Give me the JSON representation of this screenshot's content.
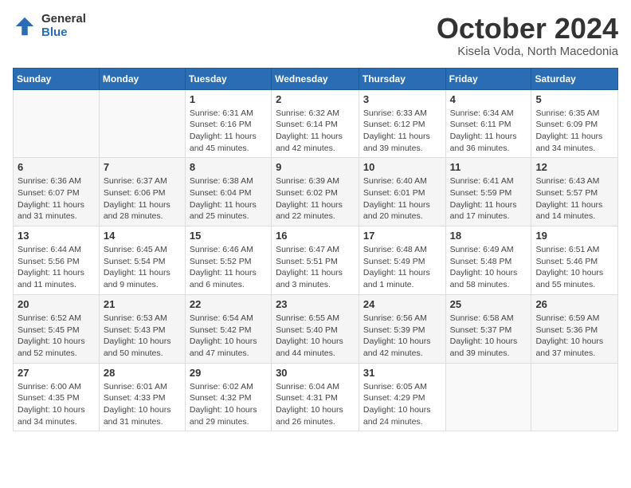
{
  "header": {
    "logo": {
      "general": "General",
      "blue": "Blue"
    },
    "title": "October 2024",
    "location": "Kisela Voda, North Macedonia"
  },
  "weekdays": [
    "Sunday",
    "Monday",
    "Tuesday",
    "Wednesday",
    "Thursday",
    "Friday",
    "Saturday"
  ],
  "weeks": [
    [
      {
        "day": "",
        "info": ""
      },
      {
        "day": "",
        "info": ""
      },
      {
        "day": "1",
        "info": "Sunrise: 6:31 AM\nSunset: 6:16 PM\nDaylight: 11 hours and 45 minutes."
      },
      {
        "day": "2",
        "info": "Sunrise: 6:32 AM\nSunset: 6:14 PM\nDaylight: 11 hours and 42 minutes."
      },
      {
        "day": "3",
        "info": "Sunrise: 6:33 AM\nSunset: 6:12 PM\nDaylight: 11 hours and 39 minutes."
      },
      {
        "day": "4",
        "info": "Sunrise: 6:34 AM\nSunset: 6:11 PM\nDaylight: 11 hours and 36 minutes."
      },
      {
        "day": "5",
        "info": "Sunrise: 6:35 AM\nSunset: 6:09 PM\nDaylight: 11 hours and 34 minutes."
      }
    ],
    [
      {
        "day": "6",
        "info": "Sunrise: 6:36 AM\nSunset: 6:07 PM\nDaylight: 11 hours and 31 minutes."
      },
      {
        "day": "7",
        "info": "Sunrise: 6:37 AM\nSunset: 6:06 PM\nDaylight: 11 hours and 28 minutes."
      },
      {
        "day": "8",
        "info": "Sunrise: 6:38 AM\nSunset: 6:04 PM\nDaylight: 11 hours and 25 minutes."
      },
      {
        "day": "9",
        "info": "Sunrise: 6:39 AM\nSunset: 6:02 PM\nDaylight: 11 hours and 22 minutes."
      },
      {
        "day": "10",
        "info": "Sunrise: 6:40 AM\nSunset: 6:01 PM\nDaylight: 11 hours and 20 minutes."
      },
      {
        "day": "11",
        "info": "Sunrise: 6:41 AM\nSunset: 5:59 PM\nDaylight: 11 hours and 17 minutes."
      },
      {
        "day": "12",
        "info": "Sunrise: 6:43 AM\nSunset: 5:57 PM\nDaylight: 11 hours and 14 minutes."
      }
    ],
    [
      {
        "day": "13",
        "info": "Sunrise: 6:44 AM\nSunset: 5:56 PM\nDaylight: 11 hours and 11 minutes."
      },
      {
        "day": "14",
        "info": "Sunrise: 6:45 AM\nSunset: 5:54 PM\nDaylight: 11 hours and 9 minutes."
      },
      {
        "day": "15",
        "info": "Sunrise: 6:46 AM\nSunset: 5:52 PM\nDaylight: 11 hours and 6 minutes."
      },
      {
        "day": "16",
        "info": "Sunrise: 6:47 AM\nSunset: 5:51 PM\nDaylight: 11 hours and 3 minutes."
      },
      {
        "day": "17",
        "info": "Sunrise: 6:48 AM\nSunset: 5:49 PM\nDaylight: 11 hours and 1 minute."
      },
      {
        "day": "18",
        "info": "Sunrise: 6:49 AM\nSunset: 5:48 PM\nDaylight: 10 hours and 58 minutes."
      },
      {
        "day": "19",
        "info": "Sunrise: 6:51 AM\nSunset: 5:46 PM\nDaylight: 10 hours and 55 minutes."
      }
    ],
    [
      {
        "day": "20",
        "info": "Sunrise: 6:52 AM\nSunset: 5:45 PM\nDaylight: 10 hours and 52 minutes."
      },
      {
        "day": "21",
        "info": "Sunrise: 6:53 AM\nSunset: 5:43 PM\nDaylight: 10 hours and 50 minutes."
      },
      {
        "day": "22",
        "info": "Sunrise: 6:54 AM\nSunset: 5:42 PM\nDaylight: 10 hours and 47 minutes."
      },
      {
        "day": "23",
        "info": "Sunrise: 6:55 AM\nSunset: 5:40 PM\nDaylight: 10 hours and 44 minutes."
      },
      {
        "day": "24",
        "info": "Sunrise: 6:56 AM\nSunset: 5:39 PM\nDaylight: 10 hours and 42 minutes."
      },
      {
        "day": "25",
        "info": "Sunrise: 6:58 AM\nSunset: 5:37 PM\nDaylight: 10 hours and 39 minutes."
      },
      {
        "day": "26",
        "info": "Sunrise: 6:59 AM\nSunset: 5:36 PM\nDaylight: 10 hours and 37 minutes."
      }
    ],
    [
      {
        "day": "27",
        "info": "Sunrise: 6:00 AM\nSunset: 4:35 PM\nDaylight: 10 hours and 34 minutes."
      },
      {
        "day": "28",
        "info": "Sunrise: 6:01 AM\nSunset: 4:33 PM\nDaylight: 10 hours and 31 minutes."
      },
      {
        "day": "29",
        "info": "Sunrise: 6:02 AM\nSunset: 4:32 PM\nDaylight: 10 hours and 29 minutes."
      },
      {
        "day": "30",
        "info": "Sunrise: 6:04 AM\nSunset: 4:31 PM\nDaylight: 10 hours and 26 minutes."
      },
      {
        "day": "31",
        "info": "Sunrise: 6:05 AM\nSunset: 4:29 PM\nDaylight: 10 hours and 24 minutes."
      },
      {
        "day": "",
        "info": ""
      },
      {
        "day": "",
        "info": ""
      }
    ]
  ]
}
